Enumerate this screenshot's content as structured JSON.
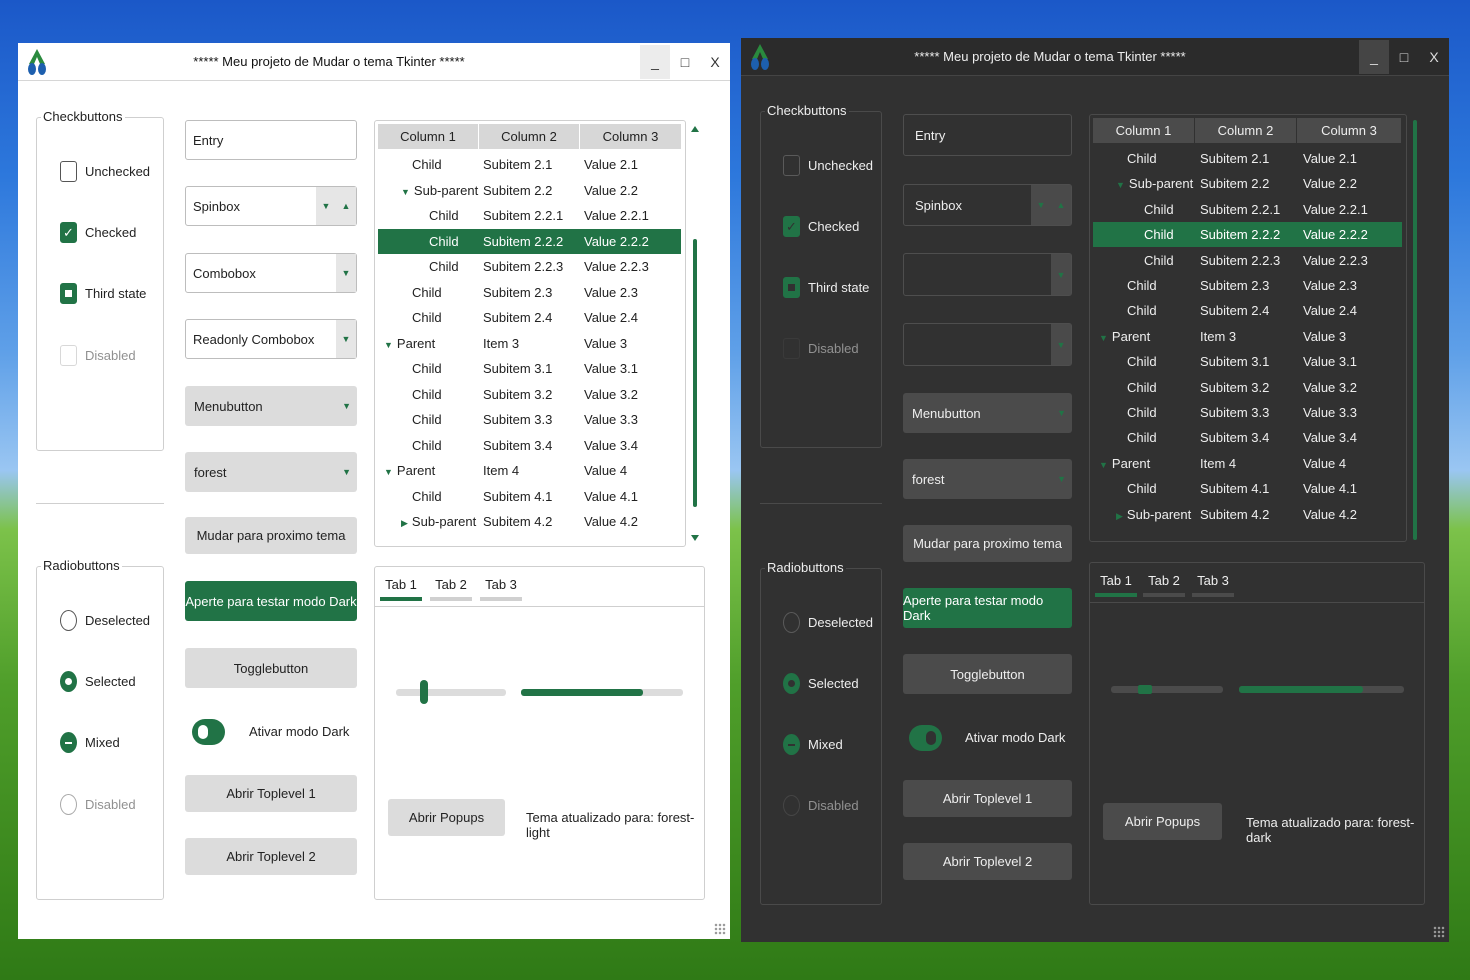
{
  "colors": {
    "accent": "#217346",
    "light_bg": "#ffffff",
    "dark_bg": "#313131"
  },
  "icons": {
    "app": "app-logo-icon",
    "minimize": "minimize-icon",
    "maximize": "maximize-icon",
    "close": "close-icon"
  },
  "windows": [
    {
      "title": "*****  Meu projeto de Mudar o tema Tkinter  *****",
      "min": "_",
      "max": "□",
      "close": "X",
      "checkbuttons": {
        "title": "Checkbuttons",
        "items": [
          "Unchecked",
          "Checked",
          "Third state",
          "Disabled"
        ]
      },
      "radiobuttons": {
        "title": "Radiobuttons",
        "items": [
          "Deselected",
          "Selected",
          "Mixed",
          "Disabled"
        ]
      },
      "entry": "Entry",
      "spinbox": "Spinbox",
      "combobox": "Combobox",
      "readonly_combobox": "Readonly Combobox",
      "menubutton": "Menubutton",
      "optionmenu": "forest",
      "btn_next_theme": "Mudar para proximo tema",
      "btn_dark": "Aperte para testar modo Dark",
      "togglebutton": "Togglebutton",
      "switch_label": "Ativar modo Dark",
      "toplevel1": "Abrir Toplevel 1",
      "toplevel2": "Abrir Toplevel 2",
      "popups": "Abrir Popups",
      "status": "Tema atualizado para: forest-light",
      "tabs": [
        "Tab 1",
        "Tab 2",
        "Tab 3"
      ],
      "scale_value": 0.25,
      "progress_value": 0.75
    },
    {
      "title": "*****  Meu projeto de Mudar o tema Tkinter  *****",
      "min": "_",
      "max": "□",
      "close": "X",
      "checkbuttons": {
        "title": "Checkbuttons",
        "items": [
          "Unchecked",
          "Checked",
          "Third state",
          "Disabled"
        ]
      },
      "radiobuttons": {
        "title": "Radiobuttons",
        "items": [
          "Deselected",
          "Selected",
          "Mixed",
          "Disabled"
        ]
      },
      "entry": "Entry",
      "spinbox": "Spinbox",
      "combobox": "",
      "readonly_combobox": "",
      "menubutton": "Menubutton",
      "optionmenu": "forest",
      "btn_next_theme": "Mudar para proximo tema",
      "btn_dark": "Aperte para testar modo Dark",
      "togglebutton": "Togglebutton",
      "switch_label": "Ativar modo Dark",
      "toplevel1": "Abrir Toplevel 1",
      "toplevel2": "Abrir Toplevel 2",
      "popups": "Abrir Popups",
      "status": "Tema atualizado para: forest-dark",
      "tabs": [
        "Tab 1",
        "Tab 2",
        "Tab 3"
      ],
      "scale_value": 0.3,
      "progress_value": 0.75
    }
  ],
  "tree": {
    "columns": [
      "Column 1",
      "Column 2",
      "Column 3"
    ],
    "rows": [
      {
        "c1": "Child",
        "c2": "Subitem 2.1",
        "c3": "Value 2.1",
        "level": 1,
        "toggle": ""
      },
      {
        "c1": "Sub-parent",
        "c2": "Subitem 2.2",
        "c3": "Value 2.2",
        "level": 1,
        "toggle": "▼"
      },
      {
        "c1": "Child",
        "c2": "Subitem 2.2.1",
        "c3": "Value 2.2.1",
        "level": 2,
        "toggle": ""
      },
      {
        "c1": "Child",
        "c2": "Subitem 2.2.2",
        "c3": "Value 2.2.2",
        "level": 2,
        "toggle": "",
        "selected": true
      },
      {
        "c1": "Child",
        "c2": "Subitem 2.2.3",
        "c3": "Value 2.2.3",
        "level": 2,
        "toggle": ""
      },
      {
        "c1": "Child",
        "c2": "Subitem 2.3",
        "c3": "Value 2.3",
        "level": 1,
        "toggle": ""
      },
      {
        "c1": "Child",
        "c2": "Subitem 2.4",
        "c3": "Value 2.4",
        "level": 1,
        "toggle": ""
      },
      {
        "c1": "Parent",
        "c2": "Item 3",
        "c3": "Value 3",
        "level": 0,
        "toggle": "▼"
      },
      {
        "c1": "Child",
        "c2": "Subitem 3.1",
        "c3": "Value 3.1",
        "level": 1,
        "toggle": ""
      },
      {
        "c1": "Child",
        "c2": "Subitem 3.2",
        "c3": "Value 3.2",
        "level": 1,
        "toggle": ""
      },
      {
        "c1": "Child",
        "c2": "Subitem 3.3",
        "c3": "Value 3.3",
        "level": 1,
        "toggle": ""
      },
      {
        "c1": "Child",
        "c2": "Subitem 3.4",
        "c3": "Value 3.4",
        "level": 1,
        "toggle": ""
      },
      {
        "c1": "Parent",
        "c2": "Item 4",
        "c3": "Value 4",
        "level": 0,
        "toggle": "▼"
      },
      {
        "c1": "Child",
        "c2": "Subitem 4.1",
        "c3": "Value 4.1",
        "level": 1,
        "toggle": ""
      },
      {
        "c1": "Sub-parent",
        "c2": "Subitem 4.2",
        "c3": "Value 4.2",
        "level": 1,
        "toggle": "▶"
      }
    ]
  }
}
